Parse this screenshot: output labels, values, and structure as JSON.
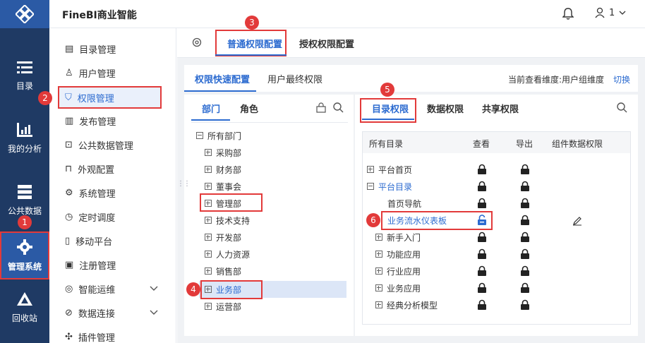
{
  "app": {
    "title": "FineBI商业智能"
  },
  "header": {
    "user_label": "1"
  },
  "rail": {
    "items": [
      {
        "label": "目录"
      },
      {
        "label": "我的分析"
      },
      {
        "label": "公共数据"
      },
      {
        "label": "管理系统"
      },
      {
        "label": "回收站"
      }
    ]
  },
  "sidebar": {
    "items": [
      {
        "label": "目录管理"
      },
      {
        "label": "用户管理"
      },
      {
        "label": "权限管理"
      },
      {
        "label": "发布管理"
      },
      {
        "label": "公共数据管理"
      },
      {
        "label": "外观配置"
      },
      {
        "label": "系统管理"
      },
      {
        "label": "定时调度"
      },
      {
        "label": "移动平台"
      },
      {
        "label": "注册管理"
      },
      {
        "label": "智能运维"
      },
      {
        "label": "数据连接"
      },
      {
        "label": "插件管理"
      }
    ]
  },
  "top_tabs": {
    "tab1": "普通权限配置",
    "tab2": "授权权限配置"
  },
  "sub_tabs": {
    "tab1": "权限快速配置",
    "tab2": "用户最终权限",
    "dimension_text": "当前查看维度:用户组维度",
    "switch": "切换"
  },
  "left_panel": {
    "tab1": "部门",
    "tab2": "角色",
    "root": "所有部门",
    "departments": [
      "采购部",
      "财务部",
      "董事会",
      "管理部",
      "技术支持",
      "开发部",
      "人力资源",
      "销售部",
      "业务部",
      "运营部"
    ]
  },
  "right_panel": {
    "tab1": "目录权限",
    "tab2": "数据权限",
    "tab3": "共享权限",
    "columns": {
      "dir": "所有目录",
      "view": "查看",
      "export": "导出",
      "component": "组件数据权限"
    },
    "rows": [
      {
        "name": "平台首页"
      },
      {
        "name": "平台目录"
      },
      {
        "name": "首页导航"
      },
      {
        "name": "业务流水仪表板"
      },
      {
        "name": "新手入门"
      },
      {
        "name": "功能应用"
      },
      {
        "name": "行业应用"
      },
      {
        "name": "业务应用"
      },
      {
        "name": "经典分析模型"
      }
    ]
  },
  "badges": [
    "1",
    "2",
    "3",
    "4",
    "5",
    "6"
  ],
  "colors": {
    "accent": "#2c6bd0",
    "highlight": "#e23a3a",
    "rail": "#1f3a64"
  }
}
